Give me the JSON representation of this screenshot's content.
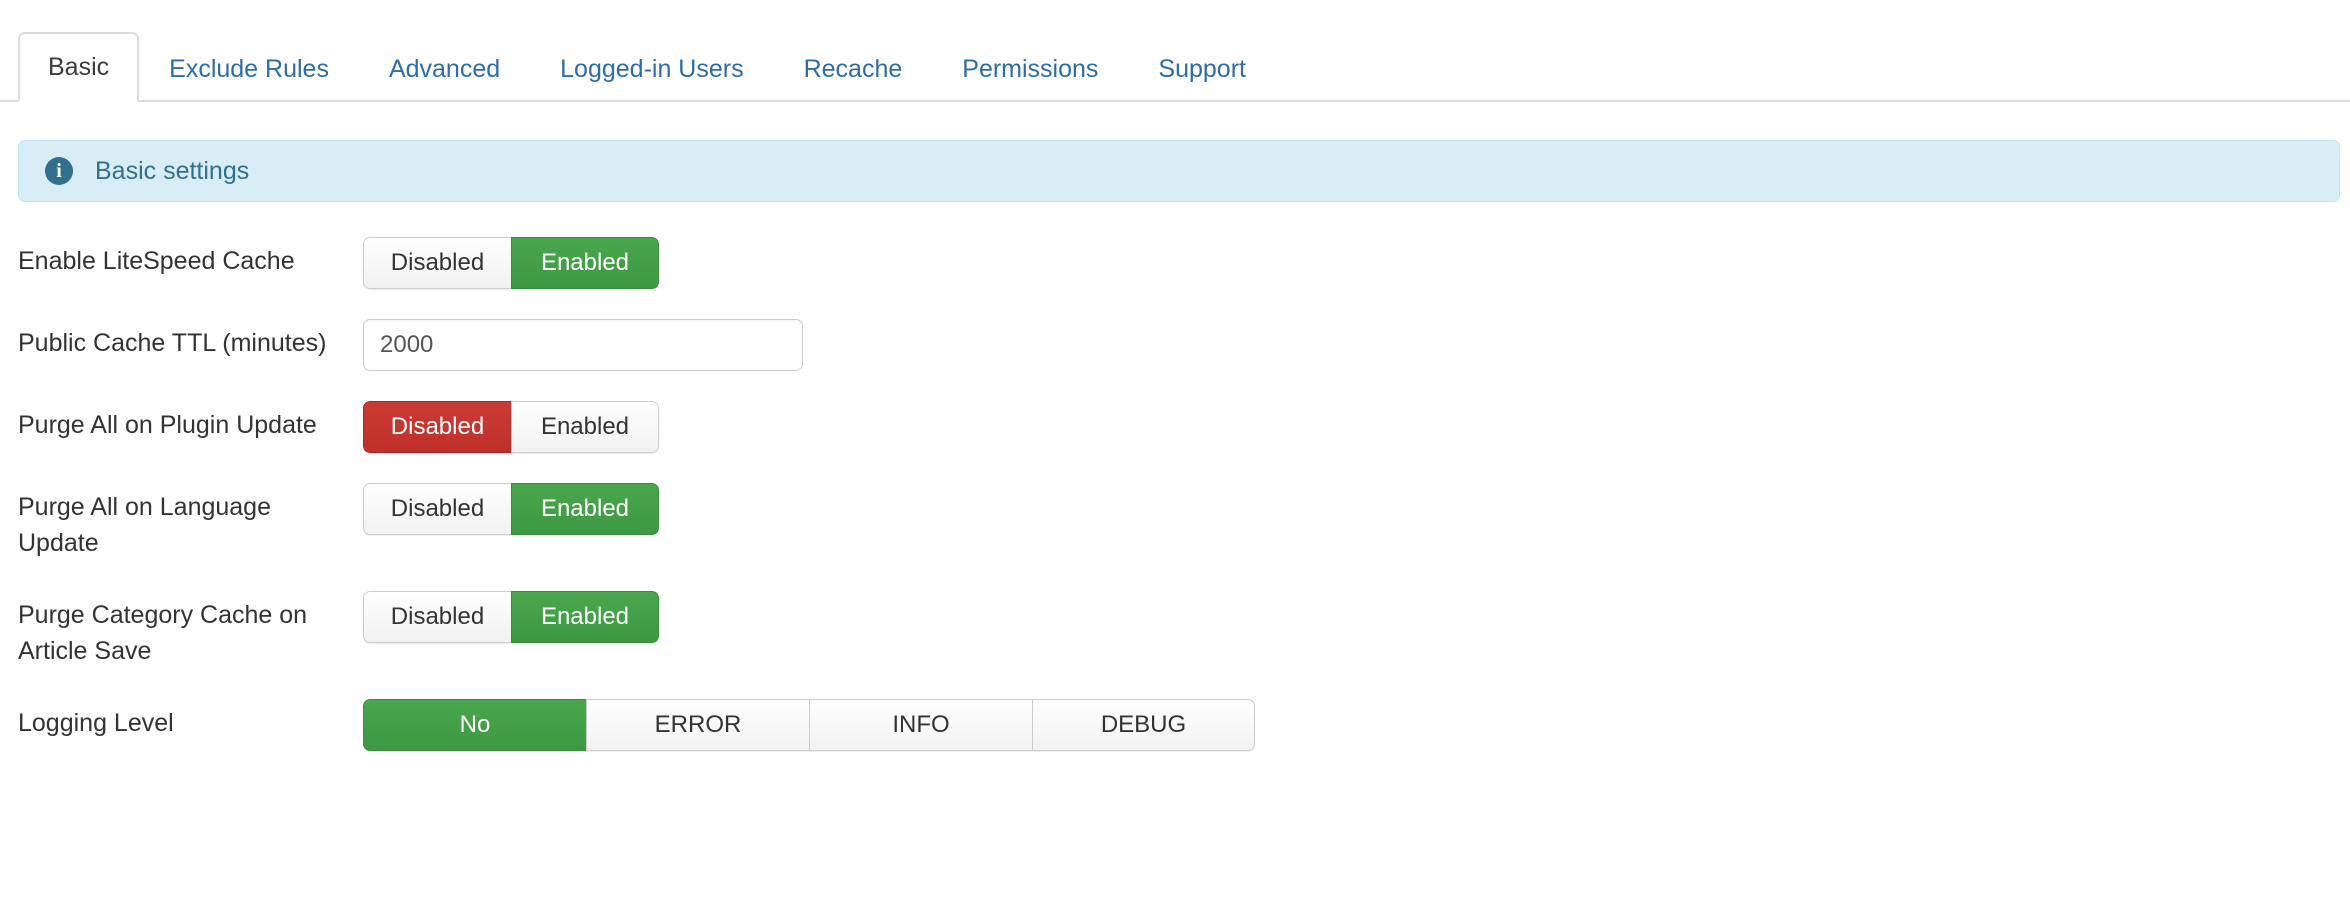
{
  "tabs": [
    {
      "label": "Basic",
      "active": true
    },
    {
      "label": "Exclude Rules",
      "active": false
    },
    {
      "label": "Advanced",
      "active": false
    },
    {
      "label": "Logged-in Users",
      "active": false
    },
    {
      "label": "Recache",
      "active": false
    },
    {
      "label": "Permissions",
      "active": false
    },
    {
      "label": "Support",
      "active": false
    }
  ],
  "banner": {
    "icon": "info-icon",
    "text": "Basic settings"
  },
  "colors": {
    "accent_blue": "#2e6da4",
    "banner_bg": "#d9edf7",
    "banner_border": "#bce8f1",
    "banner_text": "#31708f",
    "active_green": "#3d9942",
    "active_red": "#c0302b",
    "segment_bg": "#f2f2f2",
    "border_gray": "#cccccc"
  },
  "settings": [
    {
      "label": "Enable LiteSpeed Cache",
      "control": "toggle",
      "options": [
        "Disabled",
        "Enabled"
      ],
      "selected": "Enabled",
      "state": "green"
    },
    {
      "label": "Public Cache TTL (minutes)",
      "control": "input",
      "value": "2000",
      "placeholder": ""
    },
    {
      "label": "Purge All on Plugin Update",
      "control": "toggle",
      "options": [
        "Disabled",
        "Enabled"
      ],
      "selected": "Disabled",
      "state": "red"
    },
    {
      "label": "Purge All on Language Update",
      "control": "toggle",
      "options": [
        "Disabled",
        "Enabled"
      ],
      "selected": "Enabled",
      "state": "green"
    },
    {
      "label": "Purge Category Cache on Article Save",
      "control": "toggle",
      "options": [
        "Disabled",
        "Enabled"
      ],
      "selected": "Enabled",
      "state": "green"
    },
    {
      "label": "Logging Level",
      "control": "toggle-wide",
      "options": [
        "No",
        "ERROR",
        "INFO",
        "DEBUG"
      ],
      "selected": "No",
      "state": "green"
    }
  ]
}
